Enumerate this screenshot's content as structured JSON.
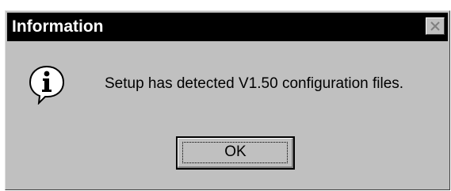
{
  "window": {
    "title": "Information",
    "close_icon": "close-icon"
  },
  "content": {
    "icon": "information-icon",
    "message": "Setup has detected V1.50 configuration files."
  },
  "buttons": {
    "ok_label": "OK"
  },
  "colors": {
    "titlebar_background": "#000000",
    "titlebar_text": "#ffffff",
    "dialog_face": "#c0c0c0"
  }
}
